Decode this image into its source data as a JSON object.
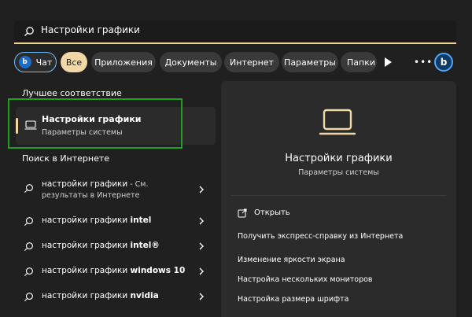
{
  "search": {
    "value": "Настройки графики",
    "icon": "search-icon"
  },
  "filters": {
    "chat": "Чат",
    "all": "Все",
    "apps": "Приложения",
    "documents": "Документы",
    "internet": "Интернет",
    "parameters": "Параметры",
    "folders": "Папки",
    "bing_letter": "b"
  },
  "best_match": {
    "section_title": "Лучшее соответствие",
    "title": "Настройки графики",
    "subtitle": "Параметры системы",
    "icon": "laptop-icon"
  },
  "web_search": {
    "section_title": "Поиск в Интернете",
    "items": [
      {
        "query": "настройки графики",
        "suffix": " - См.",
        "line2": "результаты в Интернете"
      },
      {
        "prefix": "настройки графики ",
        "bold": "intel"
      },
      {
        "prefix": "настройки графики ",
        "bold": "intel®"
      },
      {
        "prefix": "настройки графики ",
        "bold": "windows 10"
      },
      {
        "prefix": "настройки графики ",
        "bold": "nvidia"
      }
    ]
  },
  "details": {
    "title": "Настройки графики",
    "subtitle": "Параметры системы",
    "open_label": "Открыть",
    "help_heading": "Получить экспресс-справку из Интернета",
    "links": [
      "Изменение яркости экрана",
      "Настройка нескольких мониторов",
      "Настройка размера шрифта"
    ]
  },
  "colors": {
    "background": "#202020",
    "panel": "#2b2b2b",
    "accent": "#f2d8a7",
    "highlight_box": "#20a020",
    "bing_blue": "#4fa6ff"
  }
}
